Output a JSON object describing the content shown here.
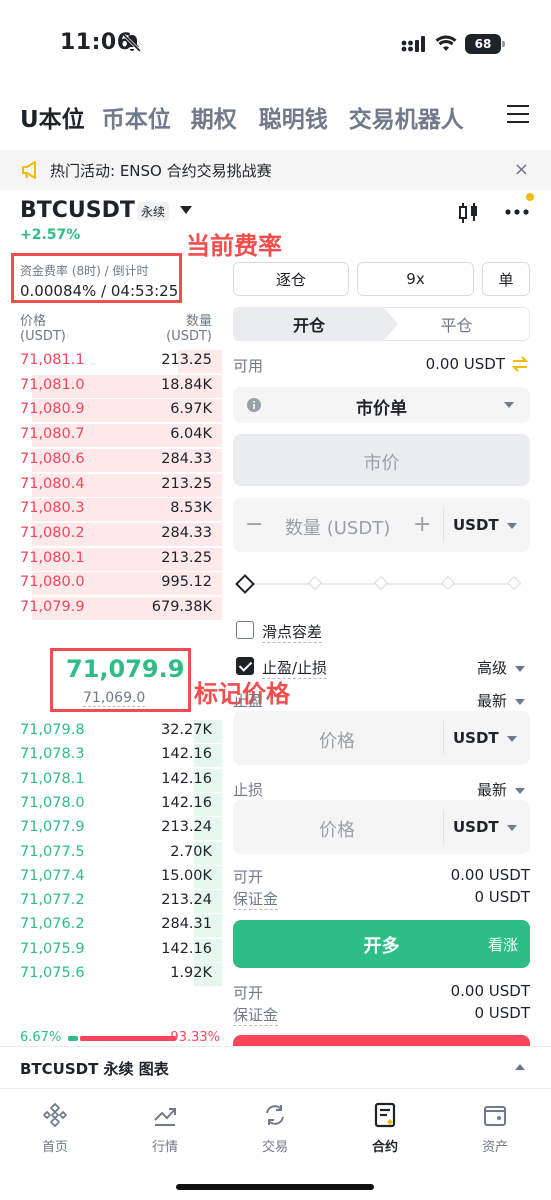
{
  "status_bar": {
    "time": "11:06",
    "battery": "68"
  },
  "top_tabs": [
    {
      "label": "U本位",
      "active": true
    },
    {
      "label": "币本位"
    },
    {
      "label": "期权"
    },
    {
      "label": "聪明钱"
    },
    {
      "label": "交易机器人"
    }
  ],
  "banner": {
    "text": "热门活动: ENSO 合约交易挑战赛",
    "close": "×"
  },
  "symbol": {
    "name": "BTCUSDT",
    "type": "永续",
    "change": "+2.57%"
  },
  "annotations": {
    "funding": "当前费率",
    "mark": "标记价格"
  },
  "funding": {
    "label": "资金费率 (8时) / 倒计时",
    "value": "0.00084% / 04:53:25"
  },
  "orderbook": {
    "price_header": "价格",
    "price_unit": "(USDT)",
    "qty_header": "数量",
    "qty_unit": "(USDT)",
    "asks": [
      {
        "price": "71,081.1",
        "qty": "213.25",
        "depth": 0.22
      },
      {
        "price": "71,081.0",
        "qty": "18.84K",
        "depth": 0.95
      },
      {
        "price": "71,080.9",
        "qty": "6.97K",
        "depth": 0.95
      },
      {
        "price": "71,080.7",
        "qty": "6.04K",
        "depth": 0.95
      },
      {
        "price": "71,080.6",
        "qty": "284.33",
        "depth": 0.95
      },
      {
        "price": "71,080.4",
        "qty": "213.25",
        "depth": 0.95
      },
      {
        "price": "71,080.3",
        "qty": "8.53K",
        "depth": 0.95
      },
      {
        "price": "71,080.2",
        "qty": "284.33",
        "depth": 0.95
      },
      {
        "price": "71,080.1",
        "qty": "213.25",
        "depth": 0.95
      },
      {
        "price": "71,080.0",
        "qty": "995.12",
        "depth": 0.95
      },
      {
        "price": "71,079.9",
        "qty": "679.38K",
        "depth": 0.95
      }
    ],
    "last_price": "71,079.9",
    "mark_price": "71,069.0",
    "bids": [
      {
        "price": "71,079.8",
        "qty": "32.27K",
        "depth": 0.14
      },
      {
        "price": "71,078.3",
        "qty": "142.16",
        "depth": 0.14
      },
      {
        "price": "71,078.1",
        "qty": "142.16",
        "depth": 0.14
      },
      {
        "price": "71,078.0",
        "qty": "142.16",
        "depth": 0.14
      },
      {
        "price": "71,077.9",
        "qty": "213.24",
        "depth": 0.14
      },
      {
        "price": "71,077.5",
        "qty": "2.70K",
        "depth": 0.14
      },
      {
        "price": "71,077.4",
        "qty": "15.00K",
        "depth": 0.14
      },
      {
        "price": "71,077.2",
        "qty": "213.24",
        "depth": 0.14
      },
      {
        "price": "71,076.2",
        "qty": "284.31",
        "depth": 0.14
      },
      {
        "price": "71,075.9",
        "qty": "142.16",
        "depth": 0.14
      },
      {
        "price": "71,075.6",
        "qty": "1.92K",
        "depth": 0.14
      }
    ],
    "buy_ratio": "6.67%",
    "sell_ratio": "93.33%"
  },
  "order_panel": {
    "margin_mode": "逐仓",
    "leverage": "9x",
    "position_mode": "单",
    "open_tab": "开仓",
    "close_tab": "平仓",
    "available_label": "可用",
    "available_value": "0.00 USDT",
    "order_type": "市价单",
    "price_placeholder": "市价",
    "qty_minus": "−",
    "qty_placeholder": "数量 (USDT)",
    "qty_plus": "+",
    "qty_unit": "USDT",
    "slippage_label": "滑点容差",
    "tpsl_label": "止盈/止损",
    "advanced_label": "高级",
    "tp_label": "止盈",
    "tp_trigger": "最新",
    "tp_placeholder": "价格",
    "tp_unit": "USDT",
    "sl_label": "止损",
    "sl_trigger": "最新",
    "sl_placeholder": "价格",
    "sl_unit": "USDT",
    "buy_open_label": "可开",
    "buy_open_value": "0.00 USDT",
    "buy_margin_label": "保证金",
    "buy_margin_value": "0 USDT",
    "buy_button": "开多",
    "buy_sub": "看涨",
    "sell_open_label": "可开",
    "sell_open_value": "0.00 USDT",
    "sell_margin_label": "保证金",
    "sell_margin_value": "0 USDT"
  },
  "chart_bar": {
    "label": "BTCUSDT 永续 图表"
  },
  "bottom_nav": [
    {
      "label": "首页",
      "icon": "home-icon"
    },
    {
      "label": "行情",
      "icon": "markets-icon"
    },
    {
      "label": "交易",
      "icon": "trade-icon"
    },
    {
      "label": "合约",
      "icon": "futures-icon",
      "active": true
    },
    {
      "label": "资产",
      "icon": "wallet-icon"
    }
  ],
  "colors": {
    "green": "#2ebd85",
    "red": "#f6465d",
    "annotation": "#f24e4e",
    "brand": "#f0b90b"
  }
}
